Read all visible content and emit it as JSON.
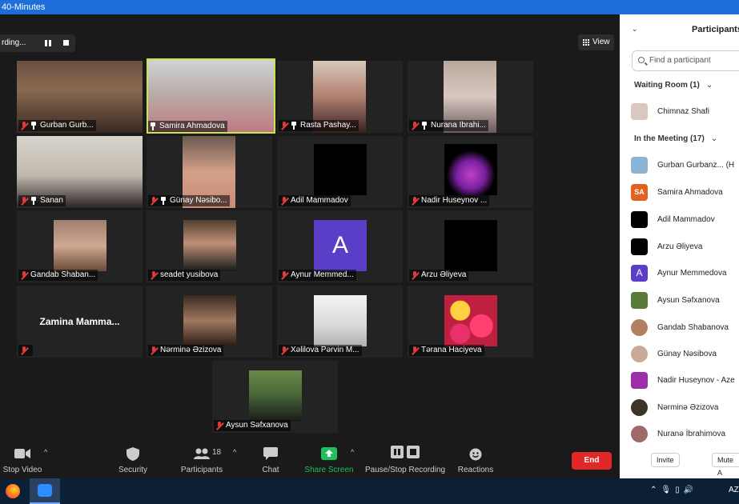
{
  "window": {
    "title": "40-Minutes"
  },
  "recording": {
    "label": "rding..."
  },
  "view_button": {
    "label": "View"
  },
  "tiles": [
    {
      "name": "Gurban Gurb...",
      "muted": true,
      "pinned": true
    },
    {
      "name": "Samira Ahmadova",
      "muted": false,
      "pinned": true,
      "active": true
    },
    {
      "name": "Rasta Pashay...",
      "muted": true,
      "pinned": true
    },
    {
      "name": "Nurana Ibrahi...",
      "muted": true,
      "pinned": true
    },
    {
      "name": "Sanan",
      "muted": true,
      "pinned": true
    },
    {
      "name": "Günay Nəsibo...",
      "muted": true,
      "pinned": true
    },
    {
      "name": "Adil Mammadov",
      "muted": true
    },
    {
      "name": "Nadir Huseynov ...",
      "muted": true
    },
    {
      "name": "Gandab Shaban...",
      "muted": true
    },
    {
      "name": "seadet yusibova",
      "muted": true
    },
    {
      "name": "Aynur Memmed...",
      "muted": true,
      "avatar_letter": "A"
    },
    {
      "name": "Arzu Əliyeva",
      "muted": true
    },
    {
      "name": "",
      "muted": true,
      "center_name": "Zamina Mamma..."
    },
    {
      "name": "Nərminə Əzizova",
      "muted": true
    },
    {
      "name": "Xəlilova Pərvin M...",
      "muted": true
    },
    {
      "name": "Tərana Haciyeva",
      "muted": true
    },
    {
      "name": "Aysun Səfxanova",
      "muted": true
    }
  ],
  "toolbar": {
    "stop_video": "Stop Video",
    "security": "Security",
    "participants": "Participants",
    "participants_count": "18",
    "chat": "Chat",
    "share_screen": "Share Screen",
    "pause_recording": "Pause/Stop Recording",
    "reactions": "Reactions",
    "end": "End"
  },
  "panel": {
    "title": "Participants",
    "search_placeholder": "Find a participant",
    "waiting_room": {
      "label": "Waiting Room",
      "count": "(1)",
      "people": [
        {
          "name": "Chimnaz Shafi",
          "color": "#d9c8c0"
        }
      ]
    },
    "in_meeting": {
      "label": "In the Meeting",
      "count": "(17)",
      "people": [
        {
          "name": "Gurban Gurbanz... (H",
          "color": "#8ab4d6",
          "initials": ""
        },
        {
          "name": "Samira Ahmadova",
          "color": "#e0621e",
          "initials": "SA"
        },
        {
          "name": "Adil Mammadov",
          "color": "#000000",
          "initials": ""
        },
        {
          "name": "Arzu Əliyeva",
          "color": "#000000",
          "initials": ""
        },
        {
          "name": "Aynur Memmedova",
          "color": "#5b3ec8",
          "initials": "A"
        },
        {
          "name": "Aysun Səfxanova",
          "color": "#5a7a3a",
          "initials": ""
        },
        {
          "name": "Gandab Shabanova",
          "color": "#b08060",
          "initials": ""
        },
        {
          "name": "Günay Nəsibova",
          "color": "#c9a99a",
          "initials": ""
        },
        {
          "name": "Nadir Huseynov - Aze",
          "color": "#9b2fa8",
          "initials": ""
        },
        {
          "name": "Nərminə Əzizova",
          "color": "#3c3428",
          "initials": ""
        },
        {
          "name": "Nuranə İbrahimova",
          "color": "#a06a6a",
          "initials": ""
        }
      ]
    },
    "invite": "Invite",
    "mute_all": "Mute A"
  },
  "taskbar": {
    "lang": "AZ"
  },
  "colors": {
    "end": "#e02828",
    "share": "#20c05c",
    "active_border": "#c8e64a",
    "titlebar": "#1d6ed8"
  }
}
